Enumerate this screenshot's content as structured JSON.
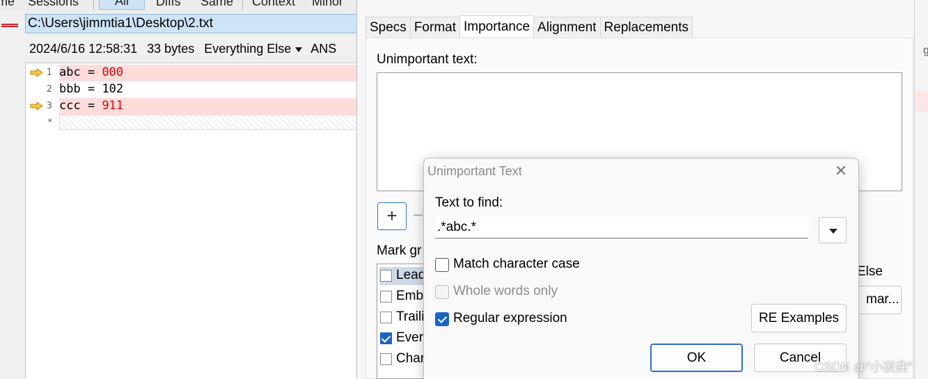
{
  "toolbar": {
    "items": [
      "me",
      "Sessions",
      "All",
      "Diffs",
      "Same",
      "Context",
      "Minor"
    ]
  },
  "file": {
    "path": "C:\\Users\\jimmtia1\\Desktop\\2.txt",
    "datetime": "2024/6/16 12:58:31",
    "size": "33 bytes",
    "format": "Everything Else",
    "encoding": "ANS"
  },
  "editor": {
    "lines": [
      {
        "num": "1",
        "name": "abc",
        "op": " = ",
        "value": "000",
        "diff": true
      },
      {
        "num": "2",
        "name": "bbb",
        "op": " = ",
        "value": "102",
        "diff": false
      },
      {
        "num": "3",
        "name": "ccc",
        "op": " = ",
        "value": "911",
        "diff": true
      },
      {
        "num": "*",
        "name": "",
        "op": "",
        "value": "",
        "diff": false
      }
    ]
  },
  "settings": {
    "tabs": [
      "Specs",
      "Format",
      "Importance",
      "Alignment",
      "Replacements"
    ],
    "active_tab": "Importance",
    "unimportant_label": "Unimportant text:",
    "add_label": "+",
    "remove_label": "−",
    "mark_label": "Mark gr",
    "mark_items": [
      {
        "label": "Leadi",
        "checked": false
      },
      {
        "label": "Embe",
        "checked": false
      },
      {
        "label": "Traili",
        "checked": false
      },
      {
        "label": "Every",
        "checked": true
      },
      {
        "label": "Chara",
        "checked": false
      }
    ],
    "else_label": "Else",
    "grammar_label": "mar..."
  },
  "dialog": {
    "title": "Unimportant Text",
    "close": "✕",
    "find_label": "Text to find:",
    "find_value": ".*abc.*",
    "options": [
      {
        "label": "Match character case",
        "checked": false,
        "enabled": true
      },
      {
        "label": "Whole words only",
        "checked": false,
        "enabled": false
      },
      {
        "label": "Regular expression",
        "checked": true,
        "enabled": true
      }
    ],
    "re_examples": "RE Examples",
    "ok": "OK",
    "cancel": "Cancel"
  },
  "right_strip_text": "g",
  "watermark": "CSDN @“小夜曲”",
  "colors": {
    "diff_bg": "#ffdcdc",
    "diff_value": "#e00000",
    "accent": "#1a64c4",
    "path_bg": "#cde4f7"
  }
}
